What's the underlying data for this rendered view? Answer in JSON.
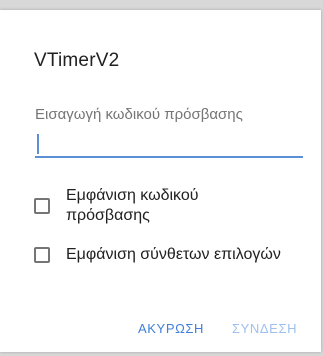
{
  "dialog": {
    "title": "VTimerV2",
    "password_field": {
      "label": "Εισαγωγή κωδικού πρόσβασης",
      "value": ""
    },
    "checkboxes": [
      {
        "label": "Εμφάνιση κωδικού πρόσβασης",
        "checked": false
      },
      {
        "label": "Εμφάνιση σύνθετων επιλογών",
        "checked": false
      }
    ],
    "buttons": {
      "cancel": "ΑΚΥΡΩΣΗ",
      "connect": "ΣΥΝΔΕΣΗ"
    },
    "colors": {
      "accent": "#3f7fd9",
      "accent_disabled": "#9ec0ee"
    }
  }
}
